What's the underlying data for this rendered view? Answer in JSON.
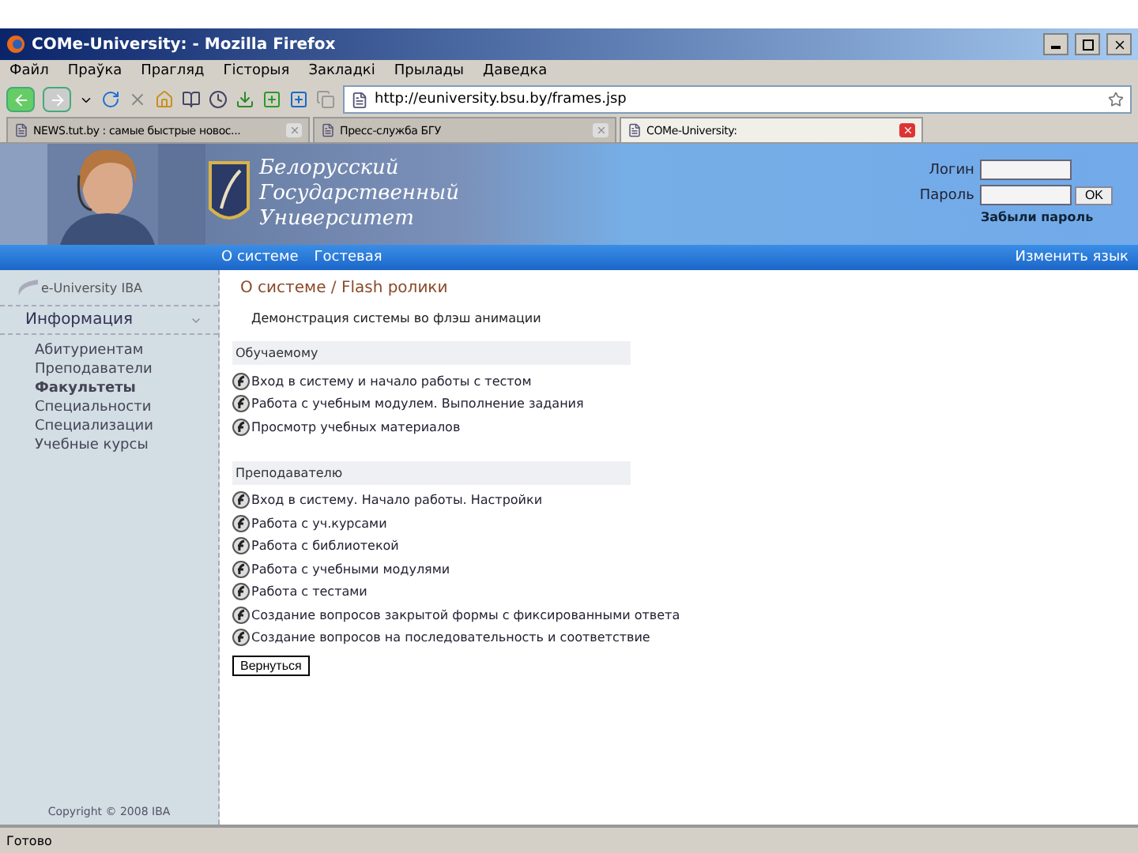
{
  "window": {
    "title": "COMe-University: - Mozilla Firefox"
  },
  "menu": [
    "Файл",
    "Праўка",
    "Прагляд",
    "Гісторыя",
    "Закладкі",
    "Прылады",
    "Даведка"
  ],
  "address": {
    "value": "http://euniversity.bsu.by/frames.jsp"
  },
  "tabs": [
    {
      "label": "NEWS.tut.by : самые быстрые новос...",
      "selected": false
    },
    {
      "label": "Пресс-служба БГУ",
      "selected": false
    },
    {
      "label": "COMe-University:",
      "selected": true
    }
  ],
  "header": {
    "university": [
      "Белорусский",
      "Государственный",
      "Университет"
    ],
    "login_label": "Логин",
    "password_label": "Пароль",
    "ok": "OK",
    "forgot": "Забыли пароль"
  },
  "nav": {
    "items": [
      "О системе",
      "Гостевая"
    ],
    "language": "Изменить язык"
  },
  "sidebar": {
    "logo": "e-University IBA",
    "section": {
      "label": "Информация",
      "expanded": true
    },
    "items": [
      {
        "label": "Абитуриентам",
        "selected": false
      },
      {
        "label": "Преподаватели",
        "selected": false
      },
      {
        "label": "Факультеты",
        "selected": true
      },
      {
        "label": "Специальности",
        "selected": false
      },
      {
        "label": "Специализации",
        "selected": false
      },
      {
        "label": "Учебные курсы",
        "selected": false
      }
    ],
    "copyright": "Copyright © 2008 IBA"
  },
  "main": {
    "breadcrumb": "О системе / Flash ролики",
    "subtitle": "Демонстрация системы во флэш анимации",
    "sections": [
      {
        "title": "Обучаемому",
        "links": [
          "Вход в систему и начало работы с тестом",
          "Работа с учебным модулем. Выполнение задания",
          "Просмотр учебных материалов"
        ]
      },
      {
        "title": "Преподавателю",
        "links": [
          "Вход в систему. Начало работы. Настройки",
          "Работа с уч.курсами",
          "Работа с библиотекой",
          "Работа с учебными модулями",
          "Работа с тестами",
          "Создание вопросов закрытой формы с фиксированными ответа",
          "Создание вопросов на последовательность и соответствие"
        ]
      }
    ],
    "back": "Вернуться"
  },
  "status_bar": {
    "text": "Готово"
  }
}
